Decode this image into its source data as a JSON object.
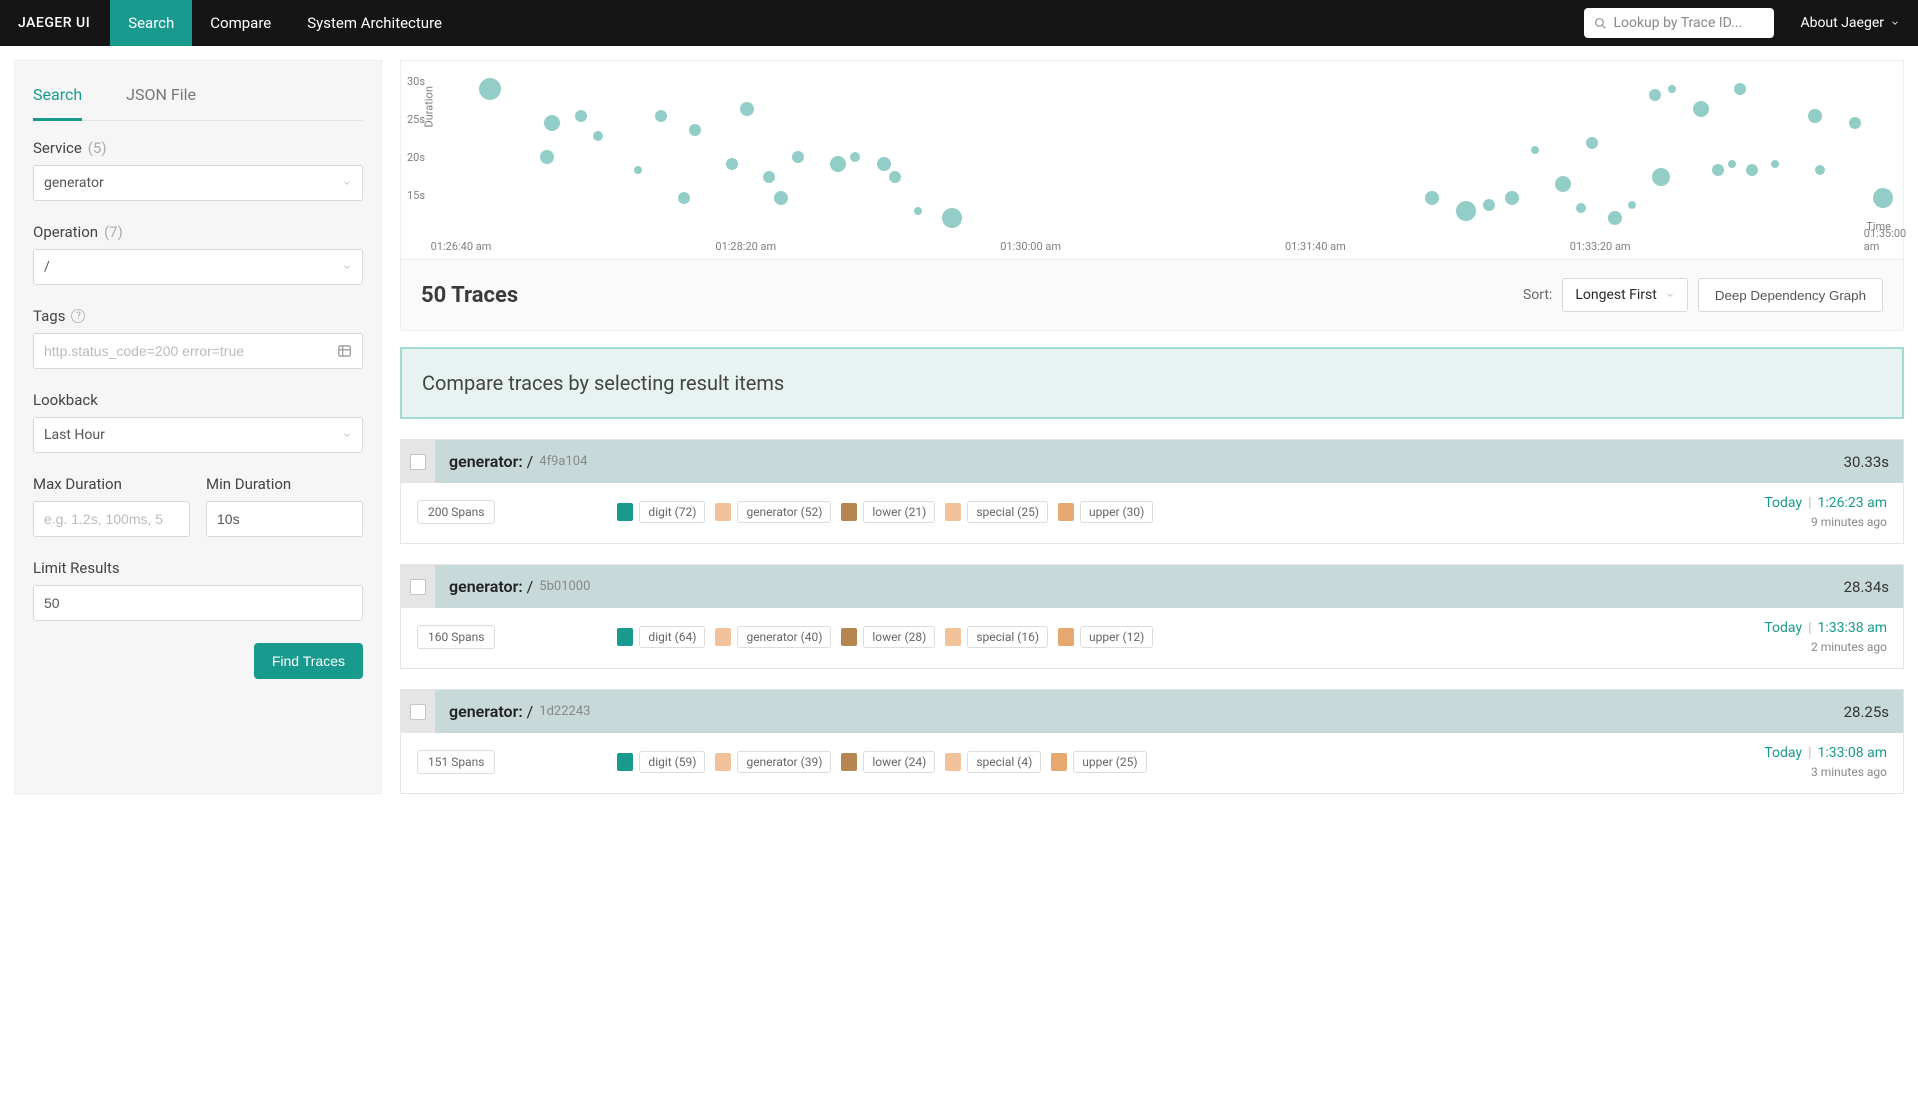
{
  "nav": {
    "logo": "JAEGER UI",
    "items": [
      "Search",
      "Compare",
      "System Architecture"
    ],
    "lookup_ph": "Lookup by Trace ID...",
    "about": "About Jaeger"
  },
  "sidebar": {
    "tabs": [
      "Search",
      "JSON File"
    ],
    "service": {
      "label": "Service",
      "count": "(5)",
      "value": "generator"
    },
    "operation": {
      "label": "Operation",
      "count": "(7)",
      "value": "/"
    },
    "tags": {
      "label": "Tags",
      "placeholder": "http.status_code=200 error=true"
    },
    "lookback": {
      "label": "Lookback",
      "value": "Last Hour"
    },
    "max": {
      "label": "Max Duration",
      "placeholder": "e.g. 1.2s, 100ms, 5"
    },
    "min": {
      "label": "Min Duration",
      "value": "10s"
    },
    "limit": {
      "label": "Limit Results",
      "value": "50"
    },
    "find": "Find Traces"
  },
  "results": {
    "count": "50 Traces",
    "sort_label": "Sort:",
    "sort_value": "Longest First",
    "deep": "Deep Dependency Graph",
    "banner": "Compare traces by selecting result items"
  },
  "chart_data": {
    "type": "scatter",
    "xlabel": "Time",
    "ylabel": "Duration",
    "y_ticks": [
      "30s",
      "25s",
      "20s",
      "15s"
    ],
    "x_ticks": [
      "01:26:40 am",
      "01:28:20 am",
      "01:30:00 am",
      "01:31:40 am",
      "01:33:20 am",
      "01:35:00 am"
    ],
    "xlim": [
      0,
      500
    ],
    "ylim": [
      10,
      32
    ],
    "points": [
      {
        "x": 10,
        "y": 30,
        "r": 11
      },
      {
        "x": 32,
        "y": 25,
        "r": 8
      },
      {
        "x": 42,
        "y": 26,
        "r": 6
      },
      {
        "x": 30,
        "y": 20,
        "r": 7
      },
      {
        "x": 48,
        "y": 23,
        "r": 5
      },
      {
        "x": 70,
        "y": 26,
        "r": 6
      },
      {
        "x": 82,
        "y": 24,
        "r": 6
      },
      {
        "x": 62,
        "y": 18,
        "r": 4
      },
      {
        "x": 78,
        "y": 14,
        "r": 6
      },
      {
        "x": 100,
        "y": 27,
        "r": 7
      },
      {
        "x": 95,
        "y": 19,
        "r": 6
      },
      {
        "x": 108,
        "y": 17,
        "r": 6
      },
      {
        "x": 118,
        "y": 20,
        "r": 6
      },
      {
        "x": 112,
        "y": 14,
        "r": 7
      },
      {
        "x": 132,
        "y": 19,
        "r": 8
      },
      {
        "x": 138,
        "y": 20,
        "r": 5
      },
      {
        "x": 148,
        "y": 19,
        "r": 7
      },
      {
        "x": 152,
        "y": 17,
        "r": 6
      },
      {
        "x": 160,
        "y": 12,
        "r": 4
      },
      {
        "x": 172,
        "y": 11,
        "r": 10
      },
      {
        "x": 340,
        "y": 14,
        "r": 7
      },
      {
        "x": 352,
        "y": 12,
        "r": 10
      },
      {
        "x": 360,
        "y": 13,
        "r": 6
      },
      {
        "x": 368,
        "y": 14,
        "r": 7
      },
      {
        "x": 376,
        "y": 21,
        "r": 4
      },
      {
        "x": 386,
        "y": 16,
        "r": 8
      },
      {
        "x": 396,
        "y": 22,
        "r": 6
      },
      {
        "x": 404,
        "y": 11,
        "r": 7
      },
      {
        "x": 392,
        "y": 12.5,
        "r": 5
      },
      {
        "x": 418,
        "y": 29,
        "r": 6
      },
      {
        "x": 424,
        "y": 30,
        "r": 4
      },
      {
        "x": 434,
        "y": 27,
        "r": 8
      },
      {
        "x": 420,
        "y": 17,
        "r": 9
      },
      {
        "x": 410,
        "y": 13,
        "r": 4
      },
      {
        "x": 448,
        "y": 30,
        "r": 6
      },
      {
        "x": 440,
        "y": 18,
        "r": 6
      },
      {
        "x": 445,
        "y": 19,
        "r": 4
      },
      {
        "x": 452,
        "y": 18,
        "r": 6
      },
      {
        "x": 460,
        "y": 19,
        "r": 4
      },
      {
        "x": 474,
        "y": 26,
        "r": 7
      },
      {
        "x": 476,
        "y": 18,
        "r": 5
      },
      {
        "x": 488,
        "y": 25,
        "r": 6
      },
      {
        "x": 498,
        "y": 14,
        "r": 10
      }
    ]
  },
  "tag_colors": {
    "digit": "#199a8e",
    "generator": "#f2c39a",
    "lower": "#b5864f",
    "special": "#f2c39a",
    "upper": "#e6a86f"
  },
  "traces": [
    {
      "name": "generator:",
      "op": "/",
      "id": "4f9a104",
      "duration": "30.33s",
      "spans": "200 Spans",
      "date": "Today",
      "time": "1:26:23 am",
      "ago": "9 minutes ago",
      "tags": [
        {
          "k": "digit",
          "n": 72
        },
        {
          "k": "generator",
          "n": 52
        },
        {
          "k": "lower",
          "n": 21
        },
        {
          "k": "special",
          "n": 25
        },
        {
          "k": "upper",
          "n": 30
        }
      ]
    },
    {
      "name": "generator:",
      "op": "/",
      "id": "5b01000",
      "duration": "28.34s",
      "spans": "160 Spans",
      "date": "Today",
      "time": "1:33:38 am",
      "ago": "2 minutes ago",
      "tags": [
        {
          "k": "digit",
          "n": 64
        },
        {
          "k": "generator",
          "n": 40
        },
        {
          "k": "lower",
          "n": 28
        },
        {
          "k": "special",
          "n": 16
        },
        {
          "k": "upper",
          "n": 12
        }
      ]
    },
    {
      "name": "generator:",
      "op": "/",
      "id": "1d22243",
      "duration": "28.25s",
      "spans": "151 Spans",
      "date": "Today",
      "time": "1:33:08 am",
      "ago": "3 minutes ago",
      "tags": [
        {
          "k": "digit",
          "n": 59
        },
        {
          "k": "generator",
          "n": 39
        },
        {
          "k": "lower",
          "n": 24
        },
        {
          "k": "special",
          "n": 4
        },
        {
          "k": "upper",
          "n": 25
        }
      ]
    }
  ]
}
